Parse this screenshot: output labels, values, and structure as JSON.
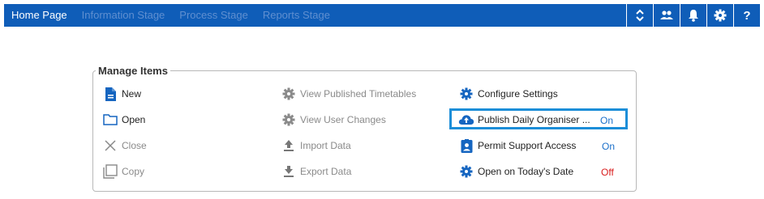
{
  "nav": {
    "tabs": [
      {
        "label": "Home Page",
        "active": true
      },
      {
        "label": "Information Stage",
        "active": false
      },
      {
        "label": "Process Stage",
        "active": false
      },
      {
        "label": "Reports Stage",
        "active": false
      }
    ],
    "tools": [
      "expand-collapse-icon",
      "users-icon",
      "bell-icon",
      "gear-icon",
      "help-icon"
    ],
    "help_label": "?"
  },
  "panel": {
    "title": "Manage Items",
    "col1": [
      {
        "label": "New",
        "icon": "document-icon",
        "enabled": true
      },
      {
        "label": "Open",
        "icon": "folder-icon",
        "enabled": true
      },
      {
        "label": "Close",
        "icon": "close-icon",
        "enabled": false
      },
      {
        "label": "Copy",
        "icon": "copy-icon",
        "enabled": false
      }
    ],
    "col2": [
      {
        "label": "View Published Timetables",
        "icon": "gear-icon",
        "enabled": false
      },
      {
        "label": "View User Changes",
        "icon": "gear-icon",
        "enabled": false
      },
      {
        "label": "Import Data",
        "icon": "upload-icon",
        "enabled": false
      },
      {
        "label": "Export Data",
        "icon": "download-icon",
        "enabled": false
      }
    ],
    "col3": [
      {
        "label": "Configure Settings",
        "icon": "gear-icon",
        "enabled": true,
        "value": ""
      },
      {
        "label": "Publish Daily Organiser ...",
        "icon": "cloud-upload-icon",
        "enabled": true,
        "value": "On"
      },
      {
        "label": "Permit Support Access",
        "icon": "id-badge-icon",
        "enabled": true,
        "value": "On"
      },
      {
        "label": "Open on Today's Date",
        "icon": "gear-icon",
        "enabled": true,
        "value": "Off"
      }
    ]
  },
  "colors": {
    "topbar": "#0f5db8",
    "on": "#1a6fc9",
    "off": "#d91c1c",
    "highlight": "#1c8ed8"
  }
}
